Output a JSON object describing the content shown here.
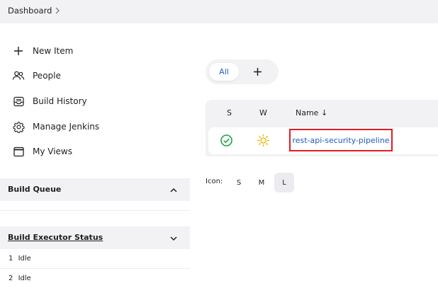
{
  "breadcrumb": {
    "dashboard": "Dashboard"
  },
  "sidebar": {
    "items": [
      {
        "label": "New Item",
        "icon": "plus-icon"
      },
      {
        "label": "People",
        "icon": "people-icon"
      },
      {
        "label": "Build History",
        "icon": "inbox-icon"
      },
      {
        "label": "Manage Jenkins",
        "icon": "gear-icon"
      },
      {
        "label": "My Views",
        "icon": "window-icon"
      }
    ]
  },
  "build_queue": {
    "title": "Build Queue"
  },
  "executor_status": {
    "title": "Build Executor Status",
    "executors": [
      {
        "number": "1",
        "state": "Idle"
      },
      {
        "number": "2",
        "state": "Idle"
      }
    ]
  },
  "view_tabs": {
    "all": "All"
  },
  "table": {
    "columns": {
      "status": "S",
      "weather": "W",
      "name": "Name ↓"
    },
    "rows": [
      {
        "status_icon": "success-check-icon",
        "weather_icon": "sunny-icon",
        "name": "rest-api-security-pipeline"
      }
    ]
  },
  "icon_size": {
    "label": "Icon:",
    "options": [
      "S",
      "M",
      "L"
    ],
    "selected": "L"
  },
  "colors": {
    "link": "#1e5eba",
    "success": "#1ea446",
    "sunny": "#f2b400",
    "highlight": "#e01b24",
    "panel": "#f2f2f5"
  }
}
